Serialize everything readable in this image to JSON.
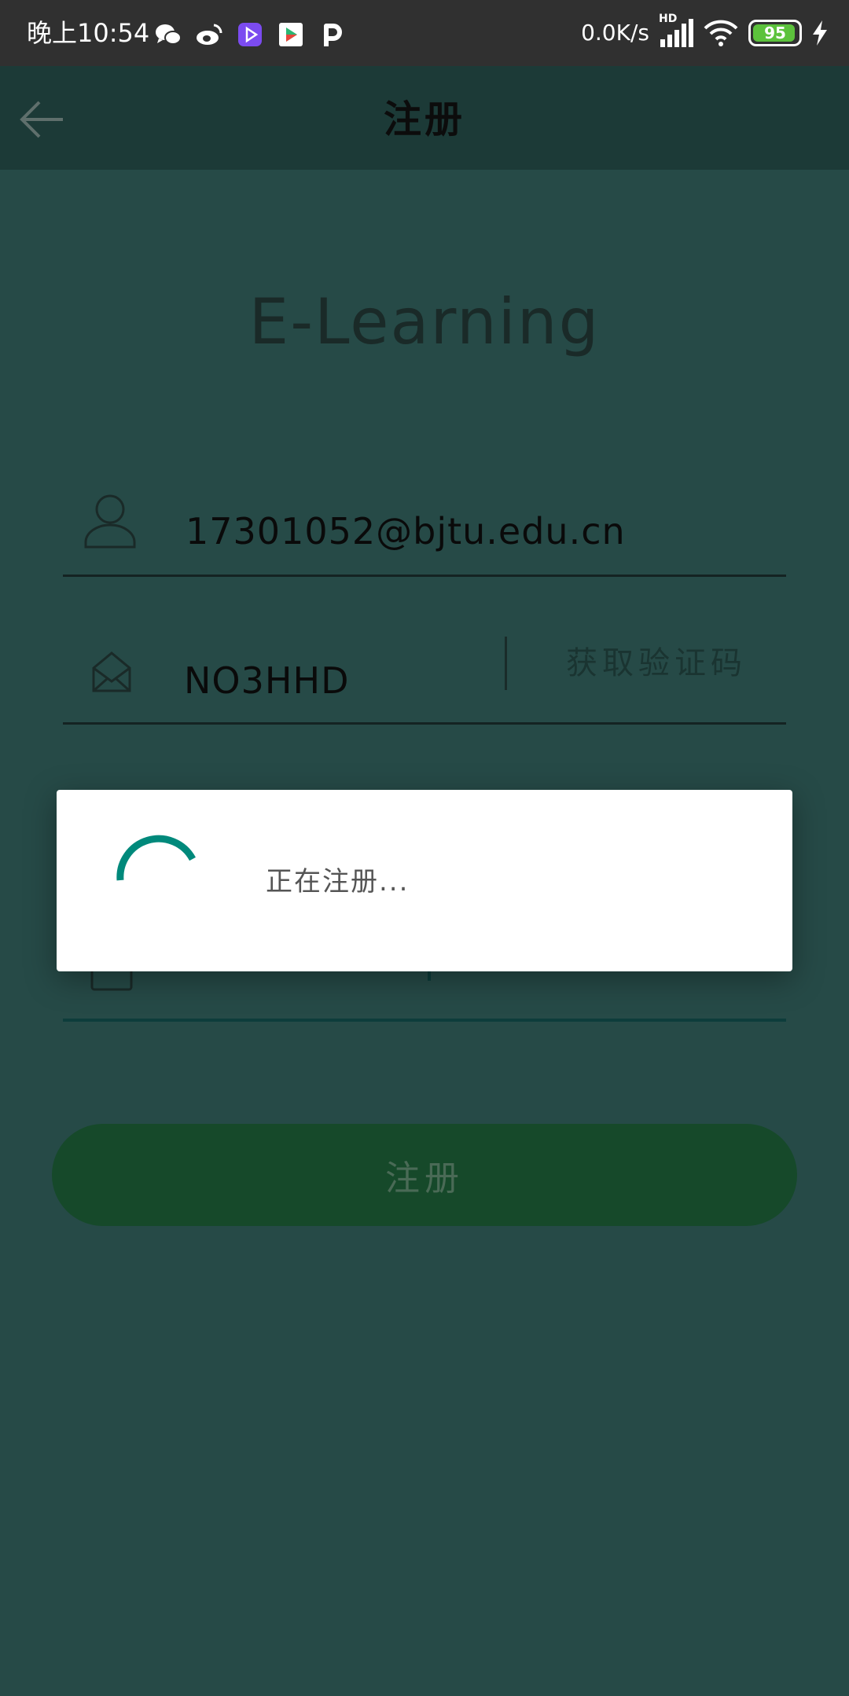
{
  "status_bar": {
    "time": "晚上10:54",
    "net_speed": "0.0K/s",
    "network_type": "HD",
    "battery_level": "95",
    "battery_fraction": 0.95,
    "app_icons": [
      "wechat-icon",
      "weibo-icon",
      "video-app-icon",
      "play-store-icon",
      "p-app-icon"
    ]
  },
  "toolbar": {
    "title": "注册"
  },
  "logo": {
    "text": "E-Learning"
  },
  "form": {
    "email_value": "17301052@bjtu.edu.cn",
    "code_value": "NO3HHD",
    "get_code_label": "获取验证码",
    "password_masked": "••••••"
  },
  "register_button": {
    "label": "注册"
  },
  "dialog": {
    "message": "正在注册..."
  },
  "colors": {
    "background": "#264a47",
    "toolbar": "#1c3a37",
    "button": "#16492a",
    "spinner": "#00897b",
    "battery": "#5cc23c"
  }
}
